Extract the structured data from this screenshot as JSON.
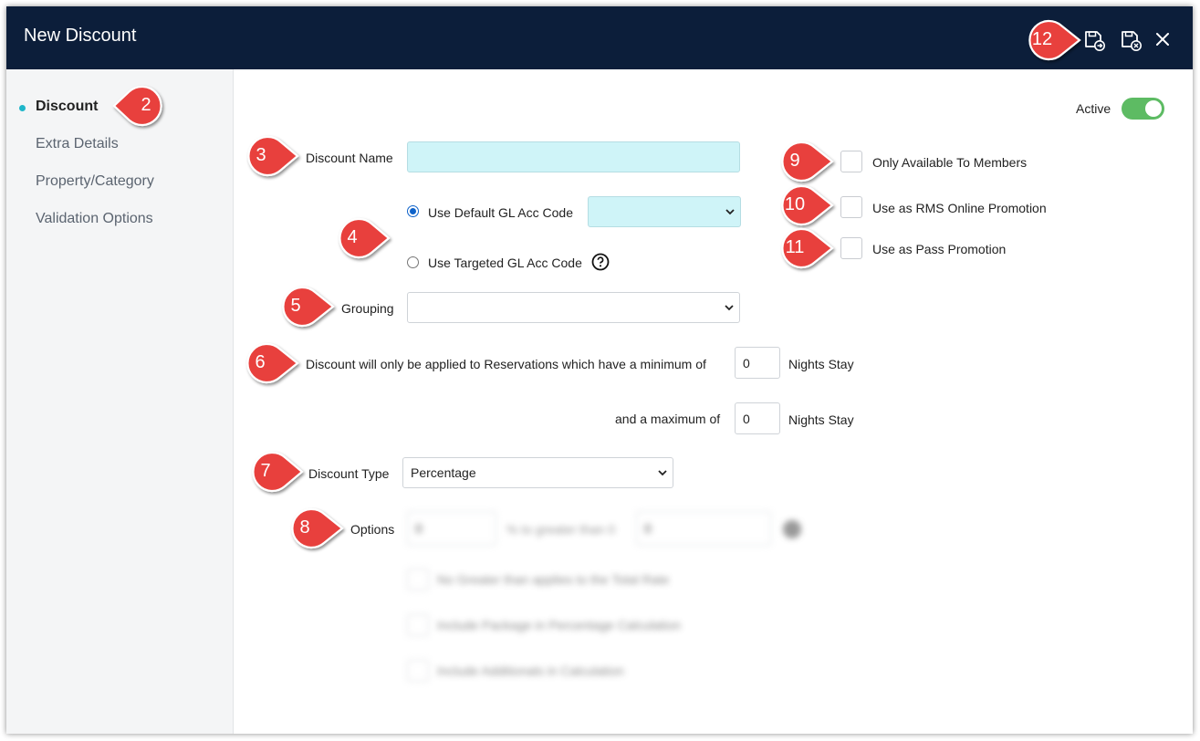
{
  "window": {
    "title": "New Discount"
  },
  "sidebar": {
    "items": [
      {
        "label": "Discount",
        "active": true
      },
      {
        "label": "Extra Details"
      },
      {
        "label": "Property/Category"
      },
      {
        "label": "Validation Options"
      }
    ]
  },
  "status": {
    "active_label": "Active",
    "active_on": true
  },
  "form": {
    "discount_name_label": "Discount Name",
    "discount_name_value": "",
    "gl_default_label": "Use Default GL Acc Code",
    "gl_targeted_label": "Use Targeted GL Acc Code",
    "gl_help_icon": "question-circle-icon",
    "grouping_label": "Grouping",
    "min_nights_label": "Discount will only be applied to Reservations which have a minimum of",
    "min_nights_value": "0",
    "nights_stay_label": "Nights Stay",
    "max_nights_label": "and a maximum of",
    "max_nights_value": "0",
    "discount_type_label": "Discount Type",
    "discount_type_value": "Percentage",
    "options_label": "Options",
    "options_value_1": "0",
    "options_mid_text": "% to greater than 0",
    "options_value_2": "0",
    "option_check_1": "No Greater than applies to the Total Rate",
    "option_check_2": "Include Package in Percentage Calculation",
    "option_check_3": "Include Additionals in Calculation",
    "members_label": "Only Available To Members",
    "rms_online_label": "Use as RMS Online Promotion",
    "pass_promo_label": "Use as Pass Promotion"
  },
  "callouts": [
    "2",
    "3",
    "4",
    "5",
    "6",
    "7",
    "8",
    "9",
    "10",
    "11",
    "12"
  ],
  "colors": {
    "titlebar": "#0c1e3a",
    "accent_cyan": "#cff4f8",
    "toggle_green": "#5dbb63",
    "callout_red": "#e8403c"
  }
}
